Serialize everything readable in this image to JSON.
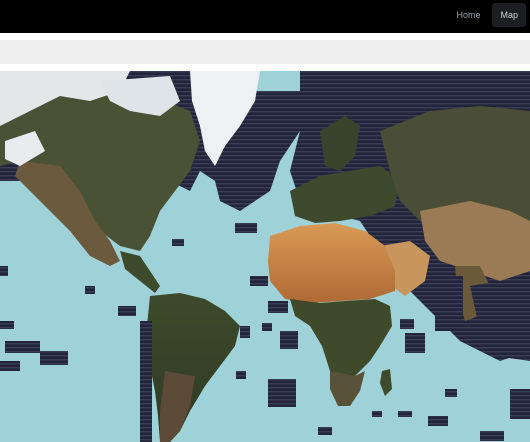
{
  "nav": {
    "links": [
      {
        "label": "Home",
        "active": false
      },
      {
        "label": "Map",
        "active": true
      }
    ]
  },
  "colors": {
    "navbar_bg": "#000000",
    "toolbar_bg": "#eeeeee",
    "ocean": "#9fd2d8",
    "tile_dark": "#23263a",
    "ice": "#f1f3f5",
    "land_dark": "#3a3f2e",
    "desert": "#d2914e"
  },
  "map": {
    "view": "satellite-mosaic-world",
    "layer_icon": "world-map"
  }
}
